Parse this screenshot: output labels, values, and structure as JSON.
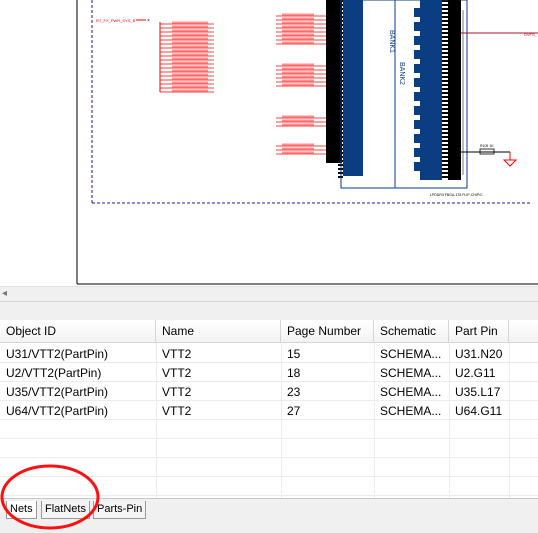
{
  "colors": {
    "net_red": "#ff0000",
    "bank_blue": "#0a3d82",
    "border_dash": "#1a1aa0"
  },
  "schematic": {
    "bank1_label": "BANK1",
    "bank2_label": "BANK2",
    "net_left": "RT_FX_PWR_SYS_B",
    "cap_label": "R105 1K",
    "part_caption": "LPDDR3 FBGA-178 FLIP-CHIP/C"
  },
  "grid": {
    "columns": [
      "Object ID",
      "Name",
      "Page Number",
      "Schematic",
      "Part Pin"
    ],
    "rows": [
      [
        "U31/VTT2(PartPin)",
        "VTT2",
        "15",
        "SCHEMA...",
        "U31.N20"
      ],
      [
        "U2/VTT2(PartPin)",
        "VTT2",
        "18",
        "SCHEMA...",
        "U2.G11"
      ],
      [
        "U35/VTT2(PartPin)",
        "VTT2",
        "23",
        "SCHEMA...",
        "U35.L17"
      ],
      [
        "U64/VTT2(PartPin)",
        "VTT2",
        "27",
        "SCHEMA...",
        "U64.G11"
      ]
    ]
  },
  "tabs": [
    {
      "label": "Nets"
    },
    {
      "label": "FlatNets"
    },
    {
      "label": "Parts-Pin"
    }
  ]
}
